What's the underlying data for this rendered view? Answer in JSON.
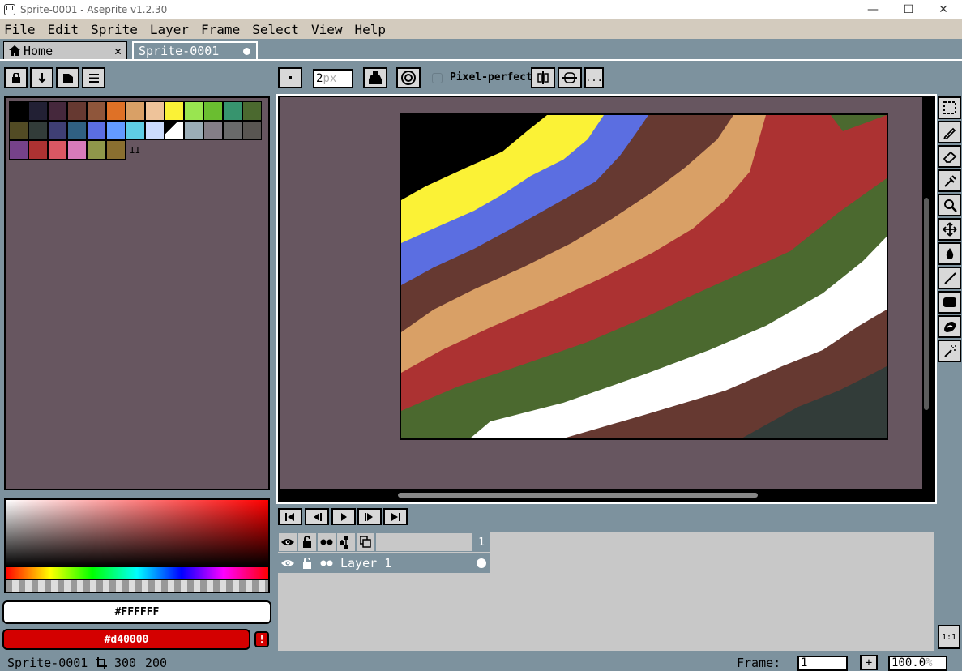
{
  "window": {
    "title": "Sprite-0001 - Aseprite v1.2.30",
    "minimize": "—",
    "maximize": "☐",
    "close": "✕"
  },
  "menu": [
    "File",
    "Edit",
    "Sprite",
    "Layer",
    "Frame",
    "Select",
    "View",
    "Help"
  ],
  "tabs": {
    "home": "Home",
    "home_close": "✕",
    "sprite": "Sprite-0001"
  },
  "toolbar": {
    "brush_size": "2",
    "brush_unit": "px",
    "pixel_perfect": "Pixel-perfect",
    "more": "..."
  },
  "palette": {
    "swatches": [
      "#000000",
      "#222034",
      "#45283c",
      "#663931",
      "#8f563b",
      "#df7126",
      "#d9a066",
      "#eec39a",
      "#fbf236",
      "#99e550",
      "#6abe30",
      "#37946e",
      "#4b692f",
      "#524b24",
      "#323c39",
      "#3f3f74",
      "#306082",
      "#5b6ee1",
      "#639bff",
      "#5fcde4",
      "#cbdbfc",
      "#ffffff",
      "#9badb7",
      "#847e87",
      "#696a6a",
      "#595652",
      "#76428a",
      "#ac3232",
      "#d95763",
      "#d77bba",
      "#8f974a",
      "#8a6f30"
    ],
    "resize_handle": "II"
  },
  "colors": {
    "foreground": "#FFFFFF",
    "background": "#d40000",
    "warning": "!"
  },
  "canvas_stripes": [
    "#000000",
    "#fbf236",
    "#5b6ee1",
    "#663931",
    "#d9a066",
    "#ac3232",
    "#4b692f",
    "#ffffff",
    "#663931",
    "#323c39"
  ],
  "tools": [
    "marquee-icon",
    "pencil-icon",
    "eraser-icon",
    "eyedropper-icon",
    "zoom-icon",
    "move-icon",
    "fill-icon",
    "line-icon",
    "rectangle-icon",
    "blur-icon",
    "spray-icon"
  ],
  "timeline": {
    "frame_number": "1",
    "layer_name": "Layer 1",
    "scale_button": "1:1"
  },
  "status": {
    "sprite_name": "Sprite-0001",
    "width": "300",
    "height": "200",
    "frame_label": "Frame:",
    "frame_value": "1",
    "plus": "+",
    "zoom_value": "100.0",
    "zoom_unit": "%"
  }
}
